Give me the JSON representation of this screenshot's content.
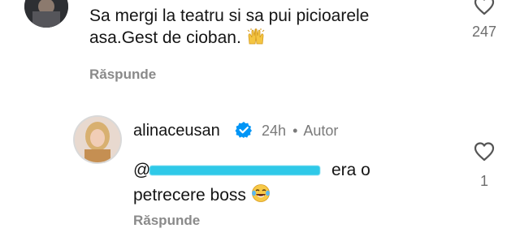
{
  "comment1": {
    "line1": "Sa mergi la teatru si sa pui picioarele",
    "line2": "asa.Gest de cioban.",
    "emoji_icon": "raised-hands-icon",
    "reply_label": "Răspunde",
    "like_count": "247"
  },
  "comment2": {
    "username": "alinaceusan",
    "verified_icon": "verified-badge-icon",
    "time": "24h",
    "separator": "•",
    "author_label": "Autor",
    "mention": "@",
    "line1_rest": "era o",
    "line2": "petrecere boss",
    "emoji_icon": "laughing-tears-icon",
    "reply_label": "Răspunde",
    "like_count": "1"
  },
  "colors": {
    "verified": "#0095f6",
    "meta": "#7a7a7a",
    "redaction": "#2fc9e8"
  }
}
